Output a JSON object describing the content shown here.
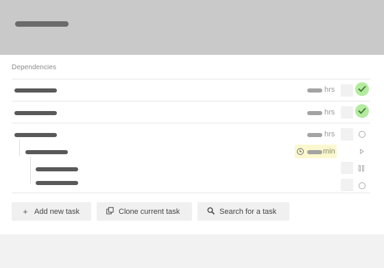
{
  "section": {
    "label": "Dependencies"
  },
  "tasks": [
    {
      "unit": "hrs",
      "status": "done"
    },
    {
      "unit": "hrs",
      "status": "done"
    },
    {
      "unit": "hrs",
      "status": "todo"
    },
    {
      "unit": "min",
      "status": "running",
      "timer_icon": "clock-icon"
    },
    {
      "status": "paused"
    },
    {
      "status": "todo"
    }
  ],
  "actions": {
    "add_label": "Add new task",
    "clone_label": "Clone current task",
    "search_label": "Search for a task"
  },
  "icons": {
    "add": "plus-icon",
    "clone": "clone-icon",
    "search": "search-icon",
    "done": "checkmark-icon",
    "todo": "circle-icon",
    "running": "play-icon",
    "paused": "pause-icon"
  },
  "colors": {
    "header": "#c9c9c9",
    "done_badge": "#b3ec9e",
    "timer_highlight": "#fbf8cf"
  }
}
